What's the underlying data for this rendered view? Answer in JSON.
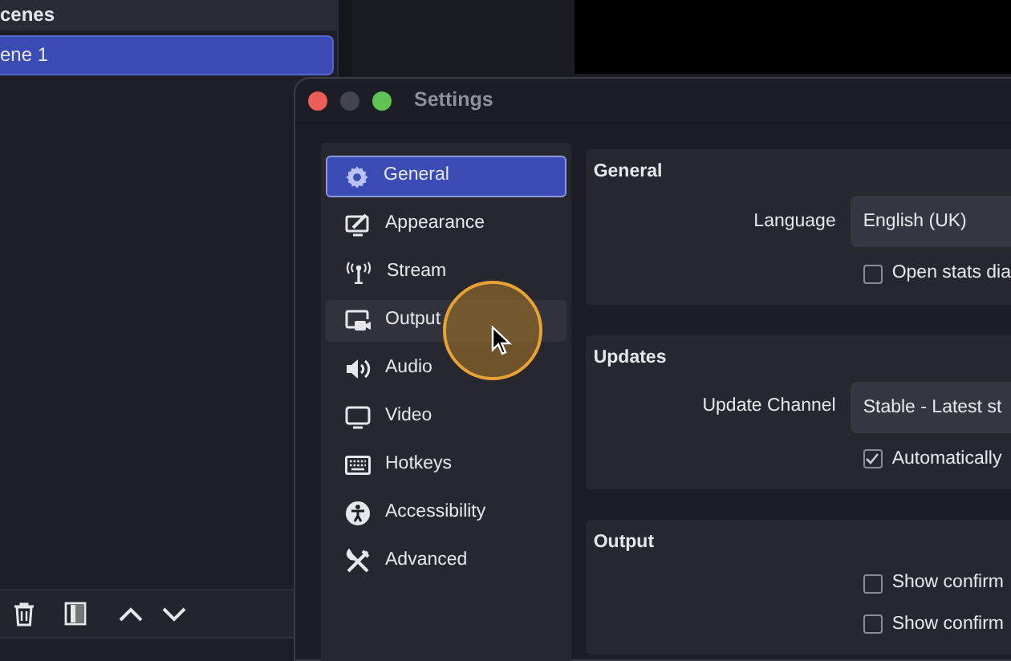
{
  "scenes_panel": {
    "title": "cenes",
    "scenes": [
      {
        "label": "ene 1",
        "selected": true
      }
    ]
  },
  "settings_window": {
    "title": "Settings",
    "sidebar": [
      {
        "label": "General",
        "selected": true,
        "hovered": false
      },
      {
        "label": "Appearance",
        "selected": false,
        "hovered": false
      },
      {
        "label": "Stream",
        "selected": false,
        "hovered": false
      },
      {
        "label": "Output",
        "selected": false,
        "hovered": true
      },
      {
        "label": "Audio",
        "selected": false,
        "hovered": false
      },
      {
        "label": "Video",
        "selected": false,
        "hovered": false
      },
      {
        "label": "Hotkeys",
        "selected": false,
        "hovered": false
      },
      {
        "label": "Accessibility",
        "selected": false,
        "hovered": false
      },
      {
        "label": "Advanced",
        "selected": false,
        "hovered": false
      }
    ],
    "groups": [
      {
        "title": "General",
        "rows": [
          {
            "kind": "select",
            "label": "Language",
            "value": "English (UK)"
          },
          {
            "kind": "checkbox",
            "label": "Open stats dia",
            "checked": false
          }
        ]
      },
      {
        "title": "Updates",
        "rows": [
          {
            "kind": "select",
            "label": "Update Channel",
            "value": "Stable - Latest st"
          },
          {
            "kind": "checkbox",
            "label": "Automatically",
            "checked": true
          }
        ]
      },
      {
        "title": "Output",
        "rows": [
          {
            "kind": "checkbox",
            "label": "Show confirm",
            "checked": false
          },
          {
            "kind": "checkbox",
            "label": "Show confirm",
            "checked": false
          }
        ]
      }
    ]
  }
}
